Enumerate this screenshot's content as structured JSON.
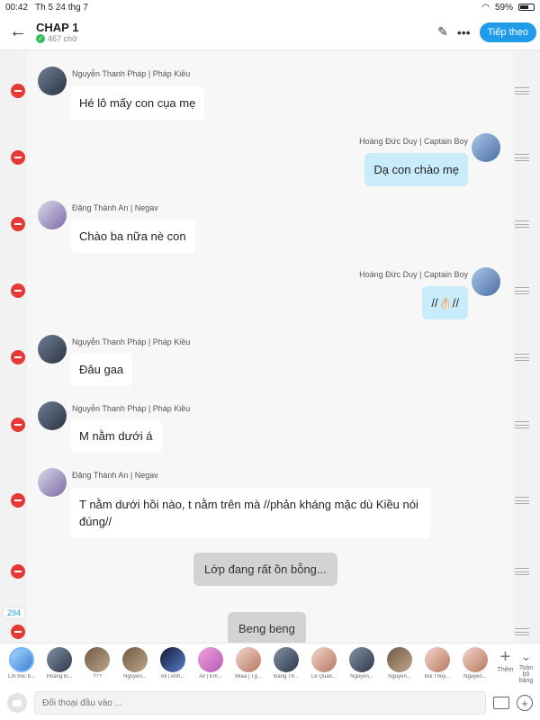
{
  "status": {
    "time": "00:42",
    "date": "Th 5 24 thg 7",
    "battery": "59%"
  },
  "header": {
    "title": "CHAP 1",
    "words": "467 chữ",
    "next_label": "Tiếp theo"
  },
  "messages": [
    {
      "name": "Nguyễn Thanh Pháp | Pháp Kiều",
      "text": "Hé lô mấy con cụa mẹ"
    },
    {
      "name": "Hoàng Đức Duy | Captain Boy",
      "text": "Dạ con chào mẹ"
    },
    {
      "name": "Đặng Thành An | Negav",
      "text": "Chào ba nữa nè con"
    },
    {
      "name": "Hoàng Đức Duy | Captain Boy",
      "text": "//👌🏻//"
    },
    {
      "name": "Nguyễn Thanh Pháp | Pháp Kiều",
      "text": "Đâu gaa"
    },
    {
      "name": "Nguyễn Thanh Pháp | Pháp Kiều",
      "text": "M nằm dưới á"
    },
    {
      "name": "Đặng Thành An | Negav",
      "text": "T nằm dưới hồi nào, t nằm trên mà //phản kháng mặc dù Kiều nói đúng//"
    }
  ],
  "narration": [
    "Lớp đang rất ồn bỗng...",
    "Beng beng"
  ],
  "count": "294",
  "characters": [
    "Lời bốc b...",
    "Hoàng Đ...",
    "???",
    "Nguyễn...",
    "All | Anh...",
    "All | Em...",
    "Miaa | Tg...",
    "Đặng Th...",
    "Lê Quan...",
    "Nguyễn...",
    "Nguyễn...",
    "Bùi Thuỳ...",
    "Nguyễn..."
  ],
  "add_label": "Thêm",
  "all_label": "Toàn bộ bảng",
  "input_placeholder": "Đối thoại đầu vào ..."
}
